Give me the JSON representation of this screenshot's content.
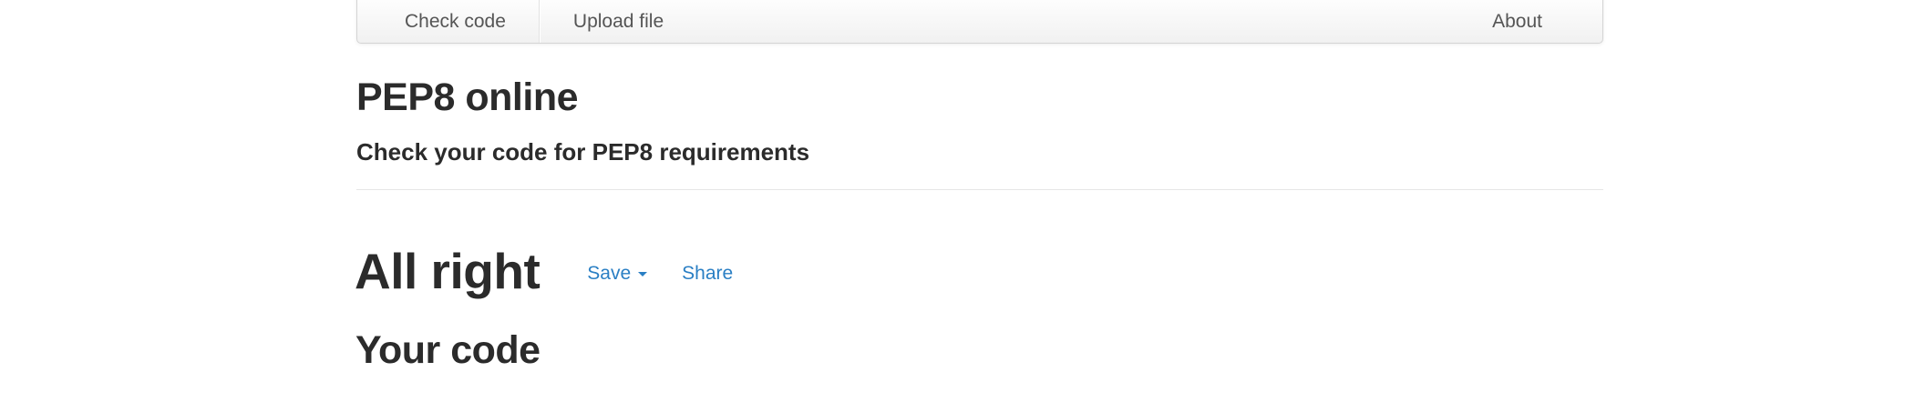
{
  "navbar": {
    "items": [
      {
        "label": "Check code"
      },
      {
        "label": "Upload file"
      }
    ],
    "about_label": "About"
  },
  "header": {
    "title": "PEP8 online",
    "subtitle": "Check your code for PEP8 requirements"
  },
  "result": {
    "title": "All right",
    "save_label": "Save",
    "share_label": "Share"
  },
  "code_section": {
    "title": "Your code"
  },
  "colors": {
    "link": "#2a7fc4",
    "heading": "#2b2b2b"
  }
}
